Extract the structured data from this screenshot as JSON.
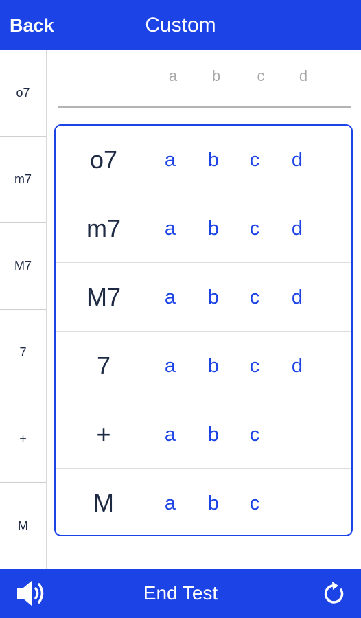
{
  "header": {
    "back_label": "Back",
    "title": "Custom"
  },
  "sidebar": {
    "items": [
      {
        "label": "o7"
      },
      {
        "label": "m7"
      },
      {
        "label": "M7"
      },
      {
        "label": "7"
      },
      {
        "label": "+"
      },
      {
        "label": "M"
      }
    ]
  },
  "columns": [
    "a",
    "b",
    "c",
    "d"
  ],
  "table": {
    "rows": [
      {
        "chord": "o7",
        "options": [
          "a",
          "b",
          "c",
          "d"
        ]
      },
      {
        "chord": "m7",
        "options": [
          "a",
          "b",
          "c",
          "d"
        ]
      },
      {
        "chord": "M7",
        "options": [
          "a",
          "b",
          "c",
          "d"
        ]
      },
      {
        "chord": "7",
        "options": [
          "a",
          "b",
          "c",
          "d"
        ]
      },
      {
        "chord": "+",
        "options": [
          "a",
          "b",
          "c"
        ]
      },
      {
        "chord": "M",
        "options": [
          "a",
          "b",
          "c"
        ]
      }
    ]
  },
  "footer": {
    "speaker_icon": "speaker-icon",
    "end_test_label": "End Test",
    "refresh_icon": "refresh-icon"
  },
  "colors": {
    "accent": "#1b43e6",
    "text_dark": "#1e2a44",
    "header_gray": "#a9a9a9"
  }
}
